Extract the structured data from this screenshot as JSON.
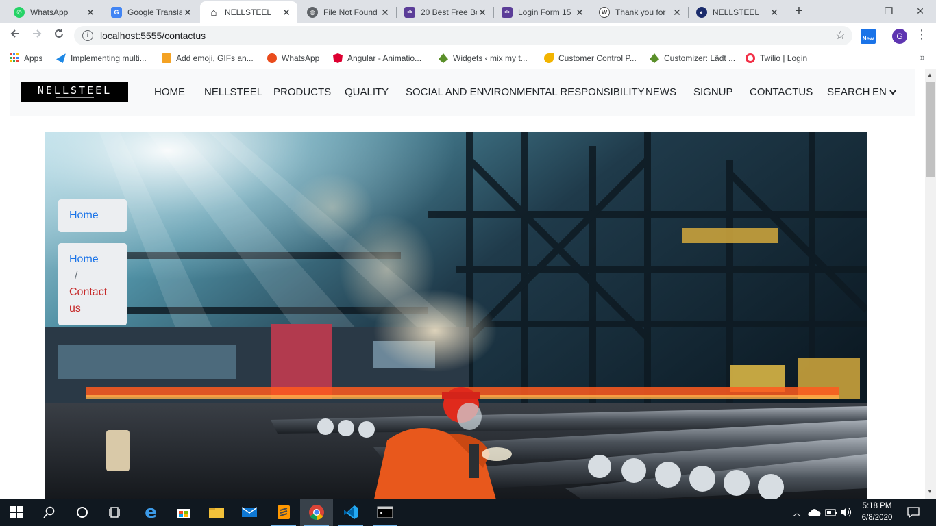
{
  "browser": {
    "tabs": [
      {
        "title": "WhatsApp",
        "icon": "whatsapp-icon",
        "color": "#25d366",
        "active": false
      },
      {
        "title": "Google Transla",
        "icon": "google-translate-icon",
        "color": "#4285f4",
        "active": false
      },
      {
        "title": "NELLSTEEL",
        "icon": "home-icon",
        "color": "#202124",
        "active": true
      },
      {
        "title": "File Not Found",
        "icon": "globe-icon",
        "color": "#5f6368",
        "active": false
      },
      {
        "title": "20 Best Free Bo",
        "icon": "colorlib-icon",
        "color": "#5b3d98",
        "active": false
      },
      {
        "title": "Login Form 15",
        "icon": "colorlib-icon",
        "color": "#5b3d98",
        "active": false
      },
      {
        "title": "Thank you for",
        "icon": "wordpress-icon",
        "color": "#464646",
        "active": false
      },
      {
        "title": "NELLSTEEL",
        "icon": "angular-icon",
        "color": "#1a2b6b",
        "active": false
      }
    ],
    "new_tab_label": "+",
    "window_controls": {
      "minimize": "—",
      "maximize": "❐",
      "close": "✕"
    },
    "url": "localhost:5555/contactus",
    "extension_label": "New",
    "profile_initial": "G",
    "bookmarks": [
      {
        "label": "Apps",
        "icon": "apps-grid-icon",
        "color": "#ea4335"
      },
      {
        "label": "Implementing multi...",
        "icon": "bird-icon",
        "color": "#1e88e5"
      },
      {
        "label": "Add emoji, GIFs an...",
        "icon": "emoji-icon",
        "color": "#f4a223"
      },
      {
        "label": "WhatsApp",
        "icon": "alert-icon",
        "color": "#ea4c1d"
      },
      {
        "label": "Angular - Animatio...",
        "icon": "angular-icon",
        "color": "#dd0031"
      },
      {
        "label": "Widgets ‹ mix my t...",
        "icon": "leaf-icon",
        "color": "#5a8f29"
      },
      {
        "label": "Customer Control P...",
        "icon": "moon-icon",
        "color": "#f2b400"
      },
      {
        "label": "Customizer: Lädt ...",
        "icon": "leaf-icon",
        "color": "#5a8f29"
      },
      {
        "label": "Twilio | Login",
        "icon": "twilio-icon",
        "color": "#f22f46"
      }
    ],
    "bookmarks_more": "»"
  },
  "site": {
    "logo_text": "NELLSTEEL",
    "nav": [
      "HOME",
      "NELLSTEEL",
      "PRODUCTS",
      "QUALITY",
      "SOCIAL AND ENVIRONMENTAL RESPONSIBILITY",
      "NEWS",
      "SIGNUP",
      "CONTACTUS",
      "SEARCH"
    ],
    "language": "EN",
    "breadcrumb_single": {
      "home": "Home"
    },
    "breadcrumb": {
      "home": "Home",
      "separator": "/",
      "current": "Contact us"
    }
  },
  "taskbar": {
    "time": "5:18 PM",
    "date": "6/8/2020",
    "apps": [
      "start-icon",
      "search-icon",
      "cortana-icon",
      "task-view-icon",
      "edge-icon",
      "store-icon",
      "file-explorer-icon",
      "mail-icon",
      "sublime-icon",
      "chrome-icon",
      "vscode-icon",
      "terminal-icon"
    ]
  },
  "colors": {
    "chrome_tabstrip": "#dee1e6",
    "nav_bg": "#f8f9fa",
    "link_blue": "#1a73e8",
    "breadcrumb_active": "#c62828",
    "taskbar": "#101820"
  }
}
